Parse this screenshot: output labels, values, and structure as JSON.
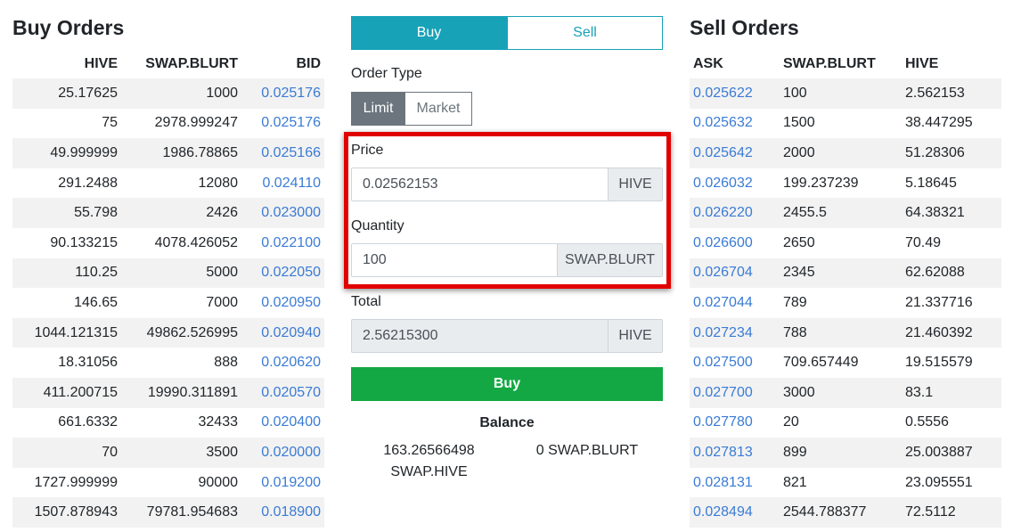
{
  "buy_orders": {
    "title": "Buy Orders",
    "headers": [
      "HIVE",
      "SWAP.BLURT",
      "BID"
    ],
    "rows": [
      [
        "25.17625",
        "1000",
        "0.025176"
      ],
      [
        "75",
        "2978.999247",
        "0.025176"
      ],
      [
        "49.999999",
        "1986.78865",
        "0.025166"
      ],
      [
        "291.2488",
        "12080",
        "0.024110"
      ],
      [
        "55.798",
        "2426",
        "0.023000"
      ],
      [
        "90.133215",
        "4078.426052",
        "0.022100"
      ],
      [
        "110.25",
        "5000",
        "0.022050"
      ],
      [
        "146.65",
        "7000",
        "0.020950"
      ],
      [
        "1044.121315",
        "49862.526995",
        "0.020940"
      ],
      [
        "18.31056",
        "888",
        "0.020620"
      ],
      [
        "411.200715",
        "19990.311891",
        "0.020570"
      ],
      [
        "661.6332",
        "32433",
        "0.020400"
      ],
      [
        "70",
        "3500",
        "0.020000"
      ],
      [
        "1727.999999",
        "90000",
        "0.019200"
      ],
      [
        "1507.878943",
        "79781.954683",
        "0.018900"
      ]
    ]
  },
  "sell_orders": {
    "title": "Sell Orders",
    "headers": [
      "ASK",
      "SWAP.BLURT",
      "HIVE"
    ],
    "rows": [
      [
        "0.025622",
        "100",
        "2.562153"
      ],
      [
        "0.025632",
        "1500",
        "38.447295"
      ],
      [
        "0.025642",
        "2000",
        "51.28306"
      ],
      [
        "0.026032",
        "199.237239",
        "5.18645"
      ],
      [
        "0.026220",
        "2455.5",
        "64.38321"
      ],
      [
        "0.026600",
        "2650",
        "70.49"
      ],
      [
        "0.026704",
        "2345",
        "62.62088"
      ],
      [
        "0.027044",
        "789",
        "21.337716"
      ],
      [
        "0.027234",
        "788",
        "21.460392"
      ],
      [
        "0.027500",
        "709.657449",
        "19.515579"
      ],
      [
        "0.027700",
        "3000",
        "83.1"
      ],
      [
        "0.027780",
        "20",
        "0.5556"
      ],
      [
        "0.027813",
        "899",
        "25.003887"
      ],
      [
        "0.028131",
        "821",
        "23.095551"
      ],
      [
        "0.028494",
        "2544.788377",
        "72.5112"
      ]
    ]
  },
  "form": {
    "tabs": {
      "buy": "Buy",
      "sell": "Sell"
    },
    "order_type_label": "Order Type",
    "order_types": {
      "limit": "Limit",
      "market": "Market"
    },
    "price": {
      "label": "Price",
      "value": "0.02562153",
      "unit": "HIVE"
    },
    "quantity": {
      "label": "Quantity",
      "value": "100",
      "unit": "SWAP.BLURT"
    },
    "total": {
      "label": "Total",
      "value": "2.56215300",
      "unit": "HIVE"
    },
    "submit_label": "Buy",
    "balance": {
      "title": "Balance",
      "left": "163.26566498 SWAP.HIVE",
      "right": "0 SWAP.BLURT"
    }
  },
  "colors": {
    "accent": "#17a2b8",
    "link": "#3a7bd5",
    "submit": "#13a843",
    "highlight": "#e10000"
  }
}
